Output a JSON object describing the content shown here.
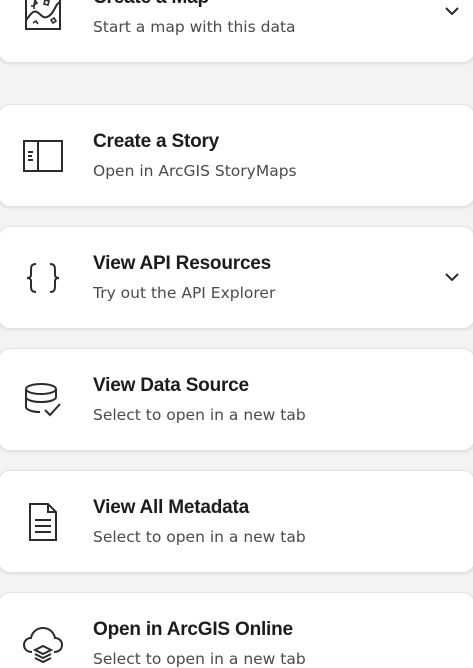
{
  "actions": [
    {
      "title": "Create a Map",
      "subtitle": "Start a map with this data",
      "icon": "map-icon",
      "expandable": true
    },
    {
      "title": "Create a Story",
      "subtitle": "Open in ArcGIS StoryMaps",
      "icon": "storymap-icon",
      "expandable": false
    },
    {
      "title": "View API Resources",
      "subtitle": "Try out the API Explorer",
      "icon": "curly-braces-icon",
      "expandable": true
    },
    {
      "title": "View Data Source",
      "subtitle": "Select to open in a new tab",
      "icon": "database-check-icon",
      "expandable": false
    },
    {
      "title": "View All Metadata",
      "subtitle": "Select to open in a new tab",
      "icon": "document-icon",
      "expandable": false
    },
    {
      "title": "Open in ArcGIS Online",
      "subtitle": "Select to open in a new tab",
      "icon": "cloud-layers-icon",
      "expandable": false
    }
  ],
  "colors": {
    "background": "#f3f3f3",
    "card": "#ffffff",
    "title": "#1c1c1c",
    "subtitle": "#4a4a4a",
    "icon": "#2b2b2b"
  }
}
